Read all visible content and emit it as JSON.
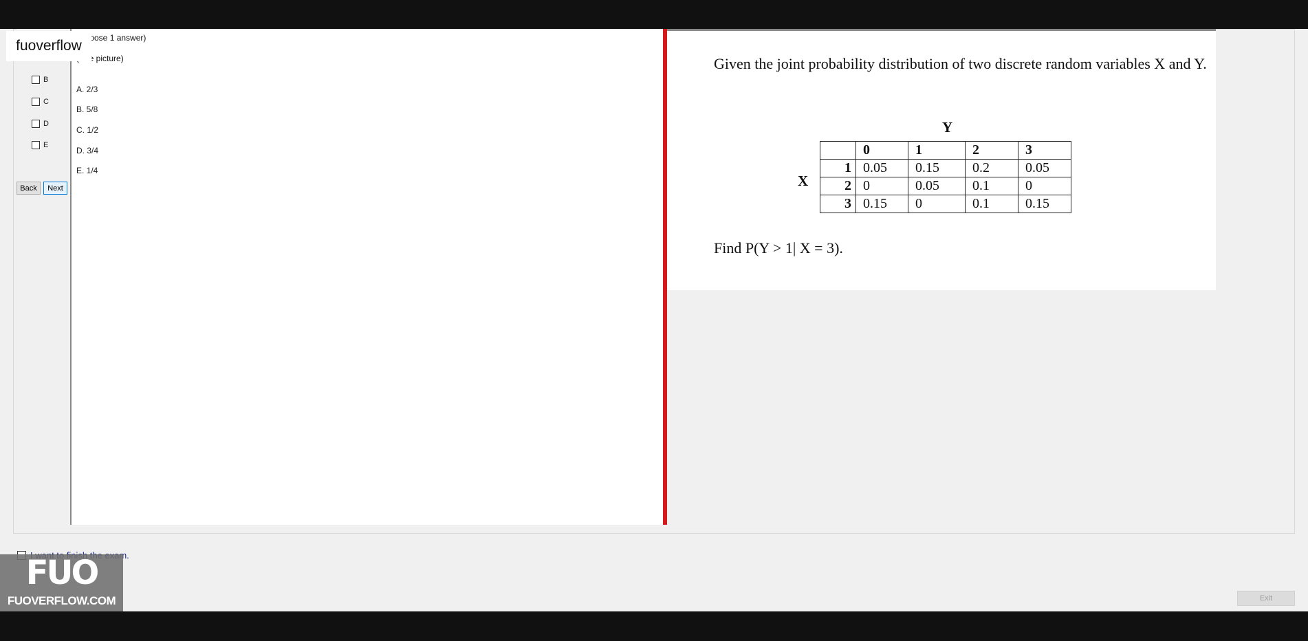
{
  "watermark": {
    "text": "fuoverflow"
  },
  "sidebar": {
    "options": [
      {
        "label": "B"
      },
      {
        "label": "C"
      },
      {
        "label": "D"
      },
      {
        "label": "E"
      }
    ],
    "back_label": "Back",
    "next_label": "Next"
  },
  "question": {
    "instruction": "(Choose 1 answer)",
    "see_picture": "(See picture)",
    "answers": [
      "A. 2/3",
      "B. 5/8",
      "C. 1/2",
      "D. 3/4",
      "E. 1/4"
    ]
  },
  "image": {
    "intro": "Given the joint probability distribution of two discrete random variables X and Y.",
    "y_label": "Y",
    "x_label": "X",
    "columns": [
      "0",
      "1",
      "2",
      "3"
    ],
    "rows": [
      {
        "x": "1",
        "values": [
          "0.05",
          "0.15",
          "0.2",
          "0.05"
        ]
      },
      {
        "x": "2",
        "values": [
          "0",
          "0.05",
          "0.1",
          "0"
        ]
      },
      {
        "x": "3",
        "values": [
          "0.15",
          "0",
          "0.1",
          "0.15"
        ]
      }
    ],
    "find": "Find P(Y > 1| X = 3)."
  },
  "footer": {
    "confirm_text": "I want to finish the exam.",
    "logo_mark": "FUO",
    "logo_text": "FUOVERFLOW.COM",
    "exit_label": "Exit"
  }
}
